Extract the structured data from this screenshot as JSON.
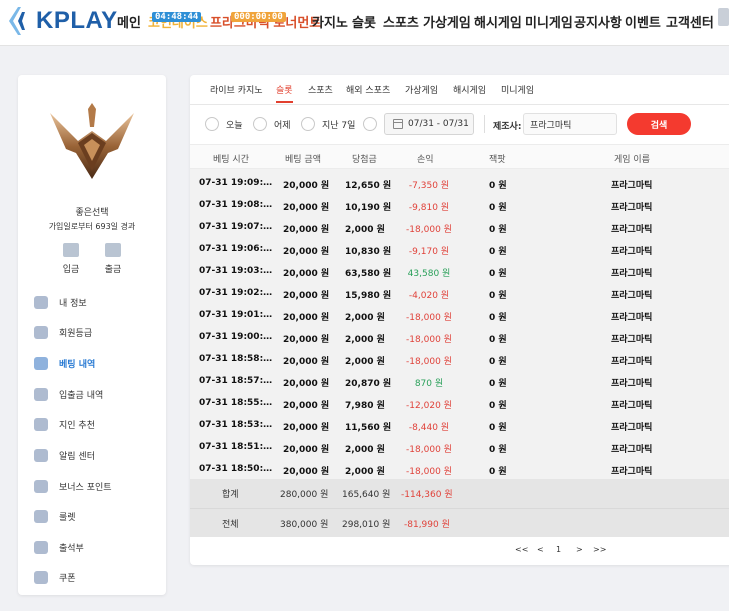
{
  "header": {
    "logo_text": "KPLAY",
    "nav": [
      {
        "label": "메인"
      },
      {
        "label": "코인레이스",
        "sub": "04:48:44"
      },
      {
        "label": "프라그마틱 토너먼트",
        "sub": "000:00:00"
      },
      {
        "label": "카지노"
      },
      {
        "label": "슬롯"
      },
      {
        "label": "스포츠"
      },
      {
        "label": "가상게임"
      },
      {
        "label": "해시게임"
      },
      {
        "label": "미니게임"
      },
      {
        "label": "공지사항"
      },
      {
        "label": "이벤트"
      },
      {
        "label": "고객센터"
      }
    ]
  },
  "sidebar": {
    "user_name": "좋은선택",
    "days_text": "가입일로부터 693일 경과",
    "deposit_label": "입금",
    "withdraw_label": "출금",
    "menu": [
      {
        "label": "내 정보",
        "icon": "profile-icon"
      },
      {
        "label": "회원등급",
        "icon": "grade-icon"
      },
      {
        "label": "베팅 내역",
        "icon": "bet-history-icon",
        "active": true
      },
      {
        "label": "입출금 내역",
        "icon": "transaction-icon"
      },
      {
        "label": "지인 추천",
        "icon": "referral-icon"
      },
      {
        "label": "알림 센터",
        "icon": "notification-icon"
      },
      {
        "label": "보너스 포인트",
        "icon": "bonus-icon"
      },
      {
        "label": "룰렛",
        "icon": "roulette-icon"
      },
      {
        "label": "출석부",
        "icon": "attendance-icon"
      },
      {
        "label": "쿠폰",
        "icon": "coupon-icon"
      }
    ]
  },
  "tabs": [
    "라이브 카지노",
    "슬롯",
    "스포츠",
    "해외 스포츠",
    "가상게임",
    "해시게임",
    "미니게임"
  ],
  "active_tab": "슬롯",
  "filter": {
    "options": [
      "오늘",
      "어제",
      "지난 7일"
    ],
    "date_range": "07/31 - 07/31",
    "maker_label": "제조사:",
    "maker_value": "프라그마틱",
    "search_label": "검색"
  },
  "table": {
    "headers": [
      "베팅 시간",
      "베팅 금액",
      "당첨금",
      "손익",
      "잭팟",
      "게임 이름"
    ],
    "rows": [
      [
        "07-31 19:09:…",
        "20,000 원",
        "12,650 원",
        "-7,350 원",
        "0 원",
        "프라그마틱"
      ],
      [
        "07-31 19:08:…",
        "20,000 원",
        "10,190 원",
        "-9,810 원",
        "0 원",
        "프라그마틱"
      ],
      [
        "07-31 19:07:…",
        "20,000 원",
        "2,000 원",
        "-18,000 원",
        "0 원",
        "프라그마틱"
      ],
      [
        "07-31 19:06:…",
        "20,000 원",
        "10,830 원",
        "-9,170 원",
        "0 원",
        "프라그마틱"
      ],
      [
        "07-31 19:03:…",
        "20,000 원",
        "63,580 원",
        "43,580 원",
        "0 원",
        "프라그마틱"
      ],
      [
        "07-31 19:02:…",
        "20,000 원",
        "15,980 원",
        "-4,020 원",
        "0 원",
        "프라그마틱"
      ],
      [
        "07-31 19:01:…",
        "20,000 원",
        "2,000 원",
        "-18,000 원",
        "0 원",
        "프라그마틱"
      ],
      [
        "07-31 19:00:…",
        "20,000 원",
        "2,000 원",
        "-18,000 원",
        "0 원",
        "프라그마틱"
      ],
      [
        "07-31 18:58:…",
        "20,000 원",
        "2,000 원",
        "-18,000 원",
        "0 원",
        "프라그마틱"
      ],
      [
        "07-31 18:57:…",
        "20,000 원",
        "20,870 원",
        "870 원",
        "0 원",
        "프라그마틱"
      ],
      [
        "07-31 18:55:…",
        "20,000 원",
        "7,980 원",
        "-12,020 원",
        "0 원",
        "프라그마틱"
      ],
      [
        "07-31 18:53:…",
        "20,000 원",
        "11,560 원",
        "-8,440 원",
        "0 원",
        "프라그마틱"
      ],
      [
        "07-31 18:51:…",
        "20,000 원",
        "2,000 원",
        "-18,000 원",
        "0 원",
        "프라그마틱"
      ],
      [
        "07-31 18:50:…",
        "20,000 원",
        "2,000 원",
        "-18,000 원",
        "0 원",
        "프라그마틱"
      ]
    ],
    "subtotal": {
      "label": "합계",
      "bet": "280,000 원",
      "win": "165,640 원",
      "pl": "-114,360 원"
    },
    "total": {
      "label": "전체",
      "bet": "380,000 원",
      "win": "298,010 원",
      "pl": "-81,990 원"
    }
  },
  "pagination": {
    "first": "<<",
    "prev": "<",
    "page": "1",
    "next": ">",
    "last": ">>"
  },
  "colors": {
    "accent": "#f43a2f",
    "brand": "#1f5fa8",
    "active_menu": "#2a7bd3",
    "loss": "#e0423a",
    "gain": "#2aa05a"
  }
}
